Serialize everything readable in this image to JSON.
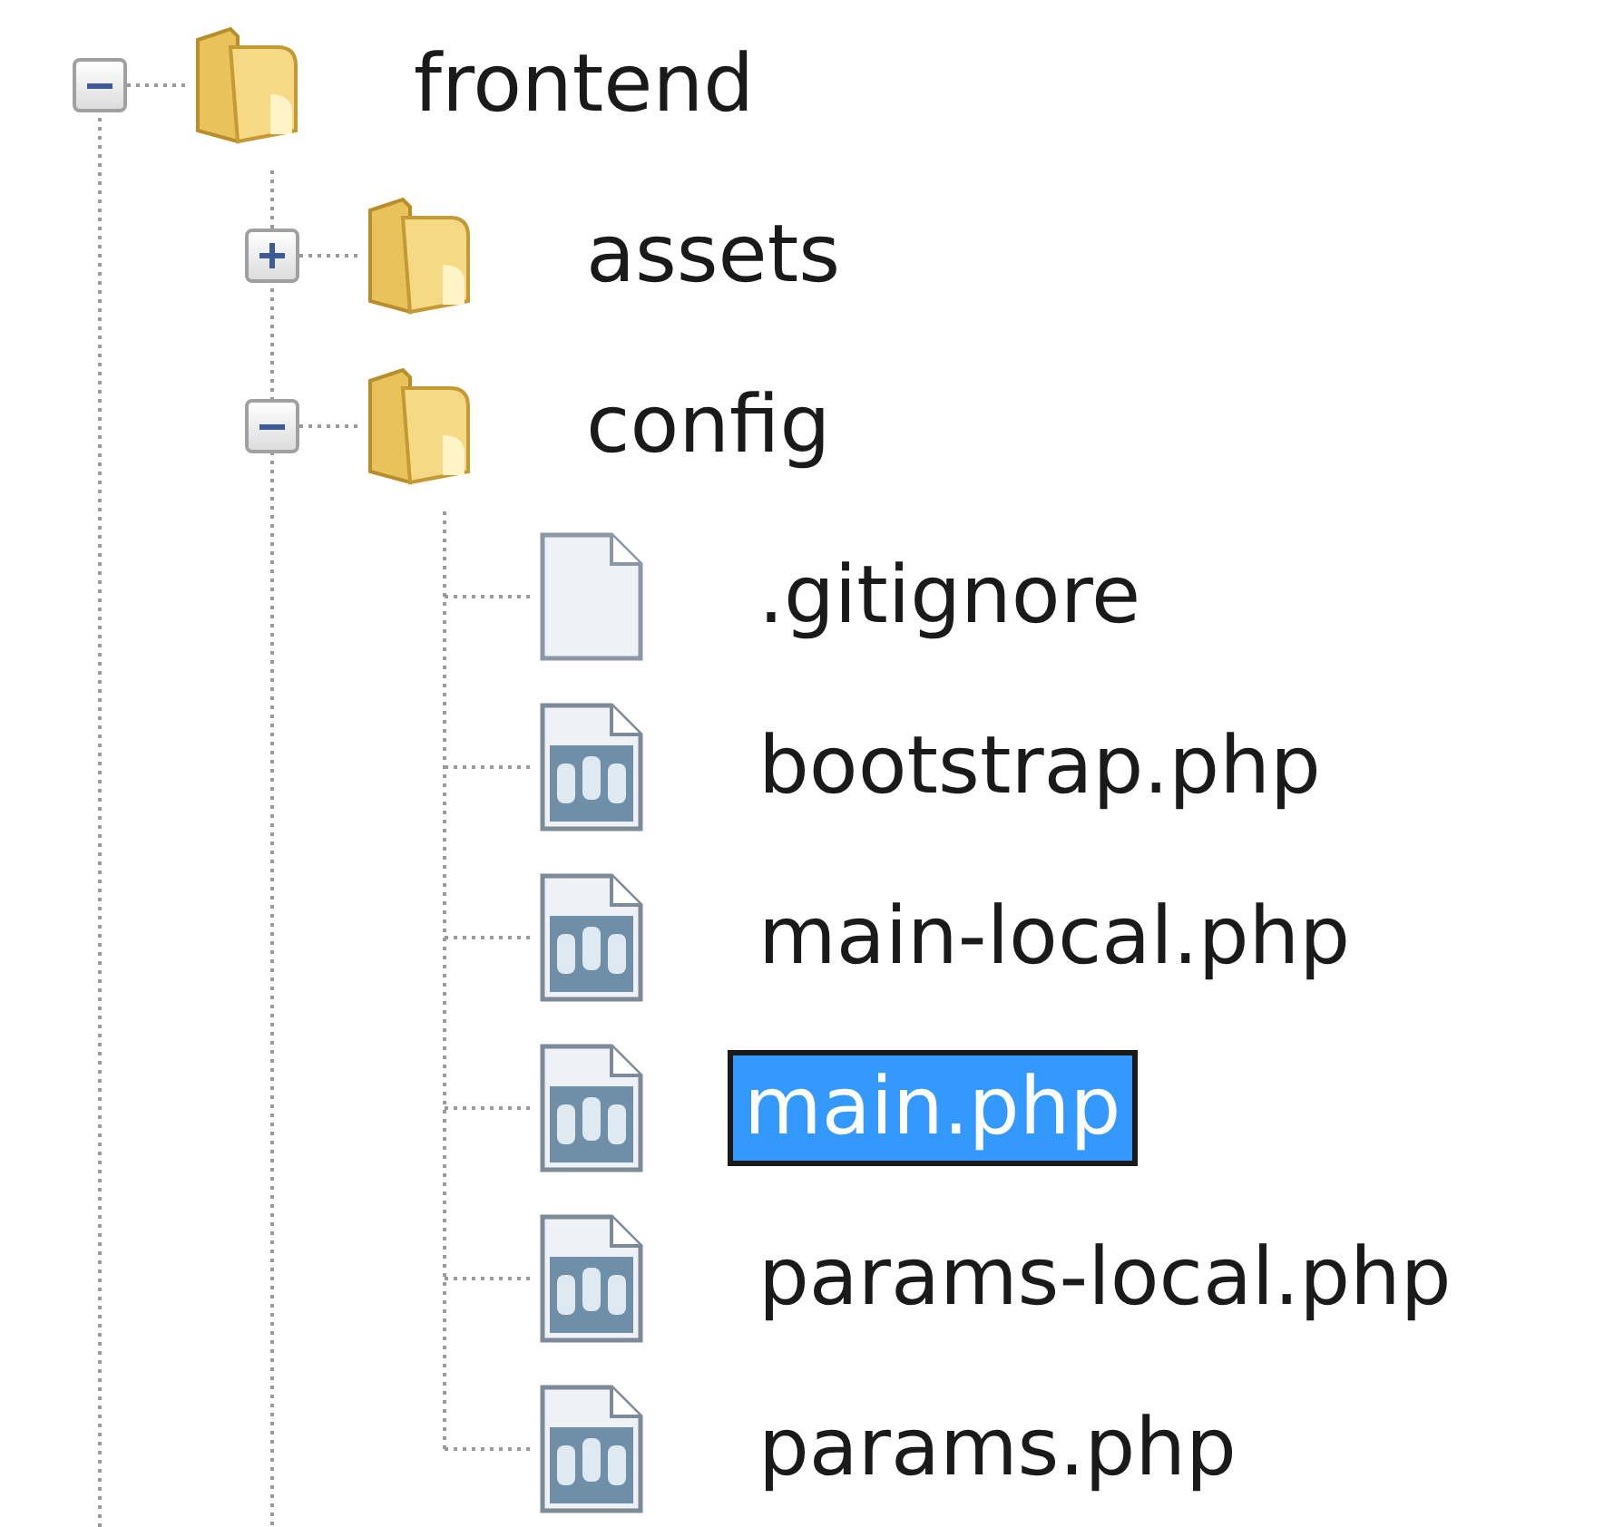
{
  "tree": [
    {
      "label": "frontend",
      "kind": "folder",
      "expanded": true,
      "selected": false,
      "children": [
        {
          "label": "assets",
          "kind": "folder",
          "expanded": false,
          "selected": false
        },
        {
          "label": "config",
          "kind": "folder",
          "expanded": true,
          "selected": false,
          "children": [
            {
              "label": ".gitignore",
              "kind": "file",
              "selected": false
            },
            {
              "label": "bootstrap.php",
              "kind": "php",
              "selected": false
            },
            {
              "label": "main-local.php",
              "kind": "php",
              "selected": false
            },
            {
              "label": "main.php",
              "kind": "php",
              "selected": true
            },
            {
              "label": "params-local.php",
              "kind": "php",
              "selected": false
            },
            {
              "label": "params.php",
              "kind": "php",
              "selected": false
            }
          ]
        }
      ]
    }
  ]
}
